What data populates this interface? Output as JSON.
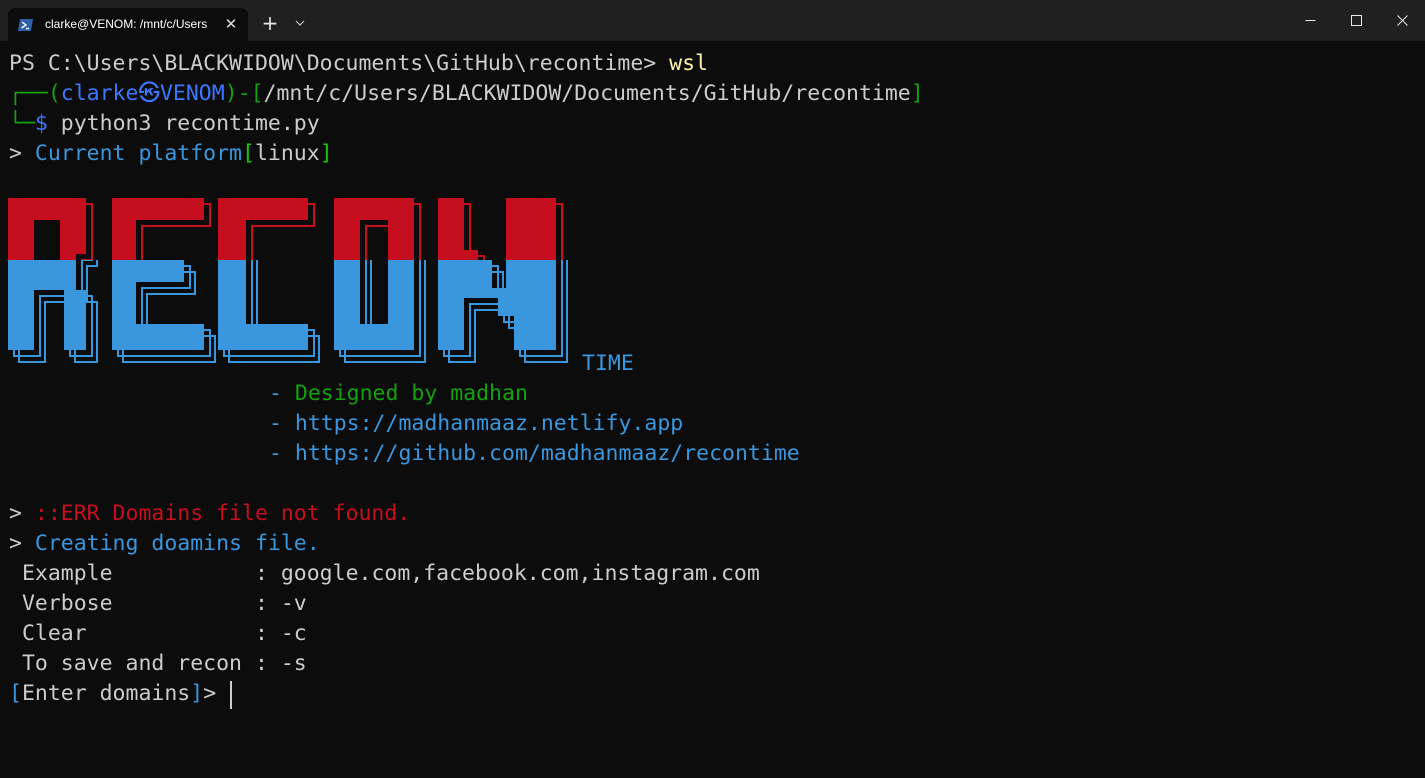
{
  "window": {
    "tab_title": "clarke@VENOM: /mnt/c/Users",
    "tab_icon": "powershell-icon",
    "close_tab_glyph": "✕",
    "new_tab_glyph": "+",
    "dropdown_glyph": "⌄"
  },
  "terminal": {
    "ps_prompt": "PS C:\\Users\\BLACKWIDOW\\Documents\\GitHub\\recontime> ",
    "ps_command": "wsl",
    "kali_prompt": {
      "corner_top": "┌──(",
      "user": "clarke",
      "at_glyph": "㉿",
      "host": "VENOM",
      "mid": ")-[",
      "path": "/mnt/c/Users/BLACKWIDOW/Documents/GitHub/recontime",
      "close": "]",
      "corner_bottom": "└─",
      "dollar": "$",
      "command": " python3 recontime.py"
    },
    "platform_line": {
      "arrow": "> ",
      "label": "Current platform",
      "open": "[",
      "value": "linux",
      "close": "]"
    },
    "banner": {
      "art_text": "RECON",
      "suffix": "TIME",
      "top_color": "#c50f1f",
      "bottom_color": "#3a96dd"
    },
    "credits": [
      {
        "dash": "- ",
        "text": "Designed by madhan"
      },
      {
        "dash": "- ",
        "text": "https://madhanmaaz.netlify.app"
      },
      {
        "dash": "- ",
        "text": "https://github.com/madhanmaaz/recontime"
      }
    ],
    "error_line": {
      "arrow": "> ",
      "text": "::ERR Domains file not found."
    },
    "info_line": {
      "arrow": "> ",
      "text": "Creating doamins file."
    },
    "help_rows": [
      {
        "label": " Example           ",
        "sep": ": ",
        "value": "google.com,facebook.com,instagram.com"
      },
      {
        "label": " Verbose           ",
        "sep": ": ",
        "value": "-v"
      },
      {
        "label": " Clear             ",
        "sep": ": ",
        "value": "-c"
      },
      {
        "label": " To save and recon ",
        "sep": ": ",
        "value": "-s"
      }
    ],
    "input_prompt": {
      "open": "[",
      "label": "Enter domains",
      "close": "]",
      "arrow": "> "
    }
  }
}
